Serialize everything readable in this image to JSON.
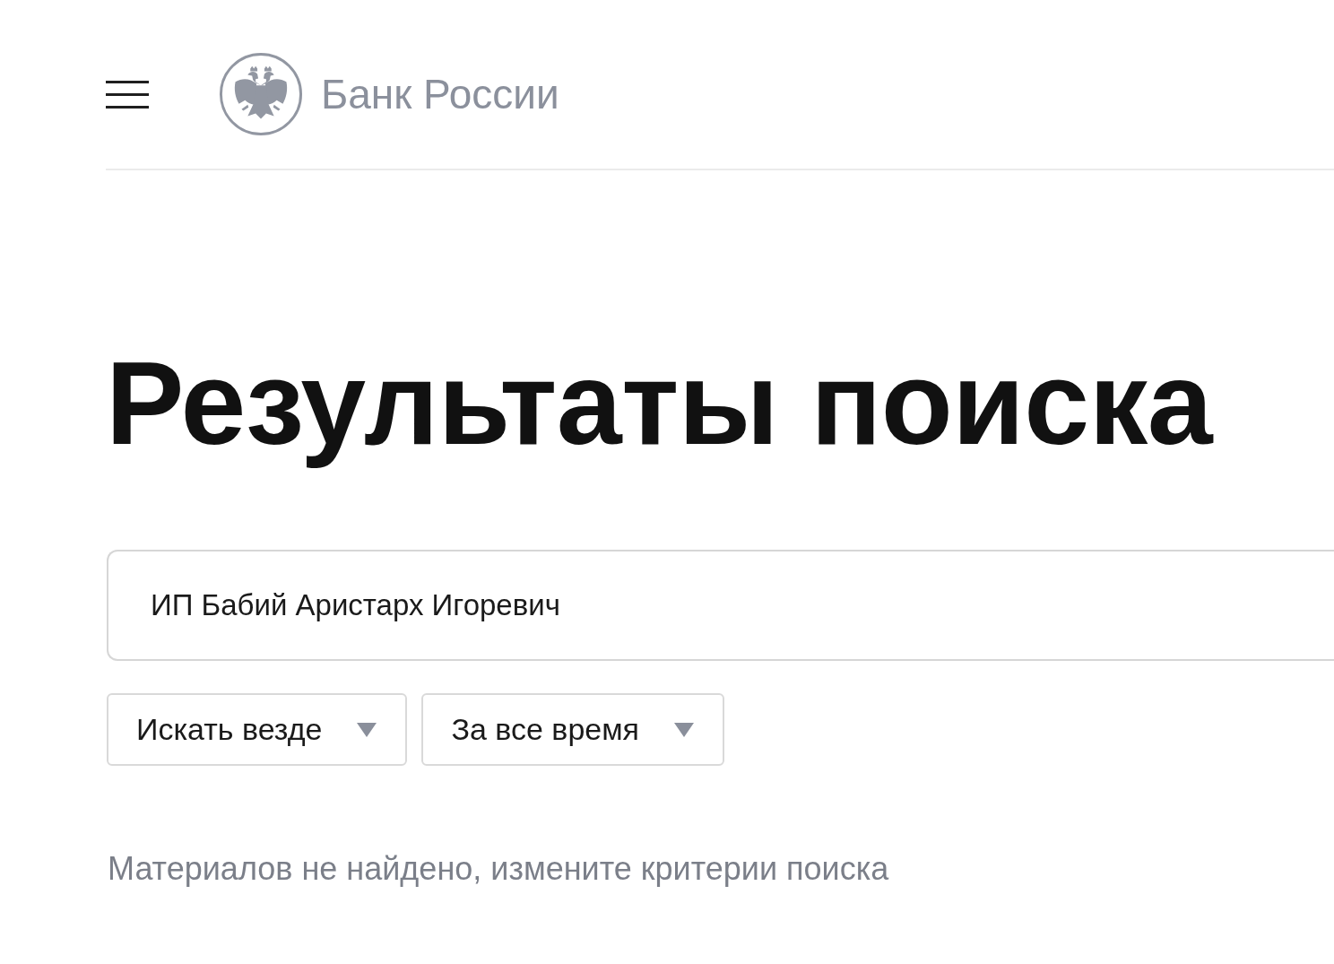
{
  "header": {
    "logo_text": "Банк России"
  },
  "title": "Результаты поиска",
  "search": {
    "value": "ИП Бабий Аристарх Игоревич"
  },
  "filters": [
    {
      "label": "Искать везде"
    },
    {
      "label": "За все время"
    }
  ],
  "message": "Материалов не найдено, измените критерии поиска"
}
